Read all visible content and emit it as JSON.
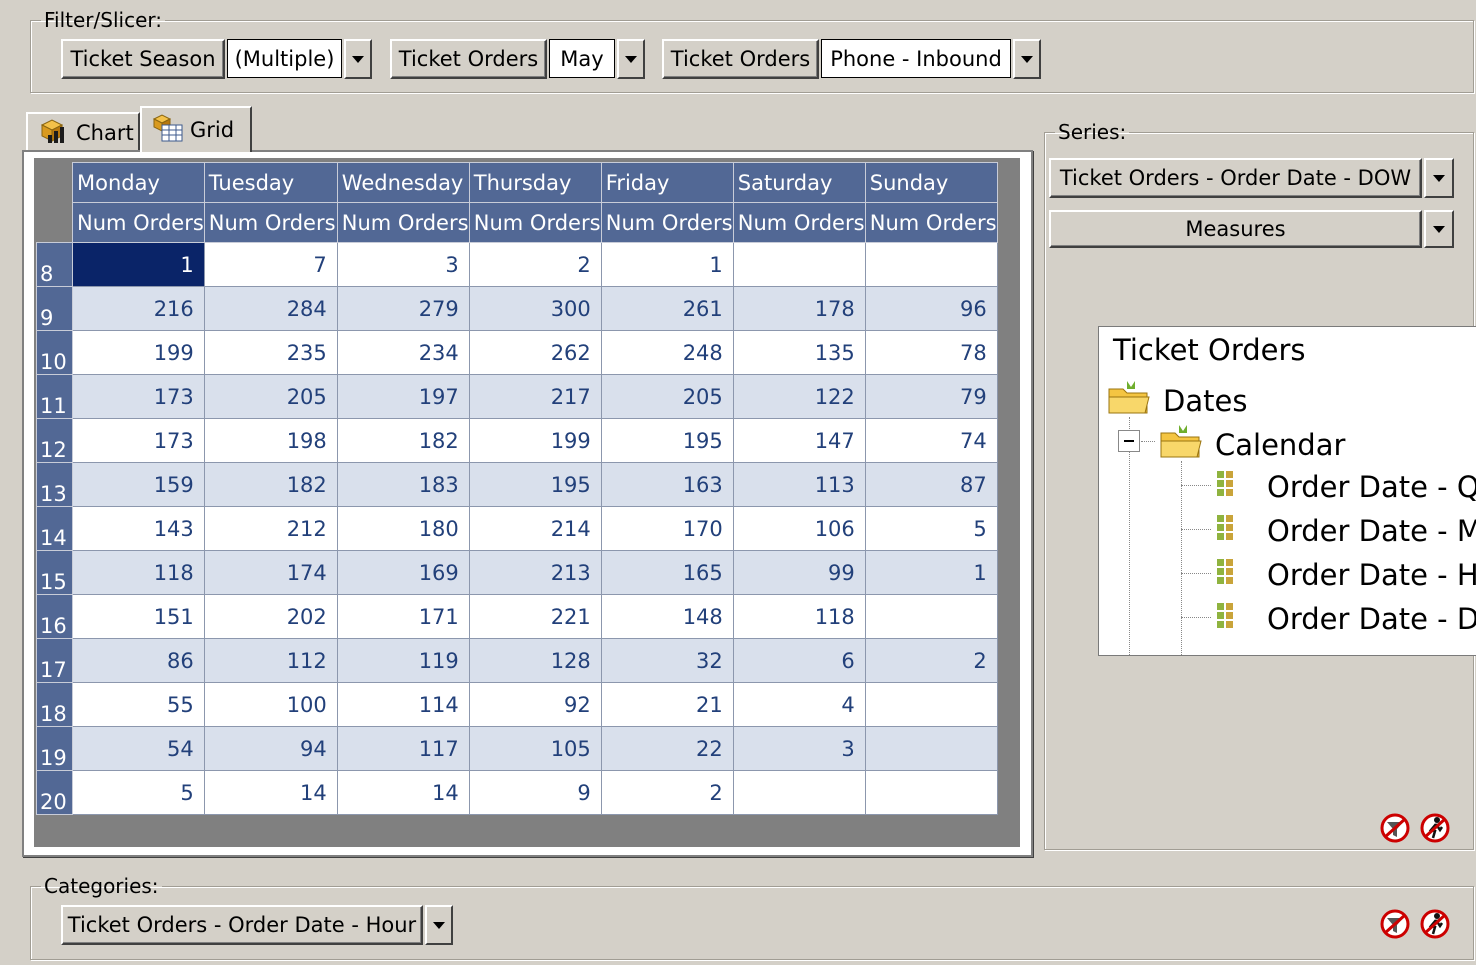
{
  "filter": {
    "legend": "Filter/Slicer:",
    "items": [
      {
        "label": "Ticket Season",
        "value": "(Multiple)"
      },
      {
        "label": "Ticket Orders",
        "value": "May"
      },
      {
        "label": "Ticket Orders",
        "value": "Phone - Inbound"
      }
    ]
  },
  "tabs": [
    {
      "label": "Chart",
      "icon": "chart-icon",
      "active": false
    },
    {
      "label": "Grid",
      "icon": "grid-icon",
      "active": true
    }
  ],
  "grid": {
    "columns": [
      "Monday",
      "Tuesday",
      "Wednesday",
      "Thursday",
      "Friday",
      "Saturday",
      "Sunday"
    ],
    "measure": "Num Orders",
    "rows": [
      {
        "hour": "8",
        "values": [
          "1",
          "7",
          "3",
          "2",
          "1",
          "",
          ""
        ]
      },
      {
        "hour": "9",
        "values": [
          "216",
          "284",
          "279",
          "300",
          "261",
          "178",
          "96"
        ]
      },
      {
        "hour": "10",
        "values": [
          "199",
          "235",
          "234",
          "262",
          "248",
          "135",
          "78"
        ]
      },
      {
        "hour": "11",
        "values": [
          "173",
          "205",
          "197",
          "217",
          "205",
          "122",
          "79"
        ]
      },
      {
        "hour": "12",
        "values": [
          "173",
          "198",
          "182",
          "199",
          "195",
          "147",
          "74"
        ]
      },
      {
        "hour": "13",
        "values": [
          "159",
          "182",
          "183",
          "195",
          "163",
          "113",
          "87"
        ]
      },
      {
        "hour": "14",
        "values": [
          "143",
          "212",
          "180",
          "214",
          "170",
          "106",
          "5"
        ]
      },
      {
        "hour": "15",
        "values": [
          "118",
          "174",
          "169",
          "213",
          "165",
          "99",
          "1"
        ]
      },
      {
        "hour": "16",
        "values": [
          "151",
          "202",
          "171",
          "221",
          "148",
          "118",
          ""
        ]
      },
      {
        "hour": "17",
        "values": [
          "86",
          "112",
          "119",
          "128",
          "32",
          "6",
          "2"
        ]
      },
      {
        "hour": "18",
        "values": [
          "55",
          "100",
          "114",
          "92",
          "21",
          "4",
          ""
        ]
      },
      {
        "hour": "19",
        "values": [
          "54",
          "94",
          "117",
          "105",
          "22",
          "3",
          ""
        ]
      },
      {
        "hour": "20",
        "values": [
          "5",
          "14",
          "14",
          "9",
          "2",
          "",
          ""
        ]
      }
    ],
    "selected_cell": {
      "row": 0,
      "col": 0
    }
  },
  "series": {
    "legend": "Series:",
    "items": [
      "Ticket Orders - Order Date - DOW",
      "Measures"
    ]
  },
  "tree": {
    "root": "Ticket Orders",
    "folder": "Dates",
    "subfolder": "Calendar",
    "leaves": [
      "Order Date - Qu",
      "Order Date - Mo",
      "Order Date - Ho",
      "Order Date - DO"
    ]
  },
  "categories": {
    "legend": "Categories:",
    "items": [
      "Ticket Orders - Order Date - Hour"
    ]
  },
  "colors": {
    "background": "#d4d0c8",
    "header": "#526895",
    "row_alt": "#d9e0ec",
    "selected": "#0a2468",
    "cell_text": "#22407a"
  }
}
